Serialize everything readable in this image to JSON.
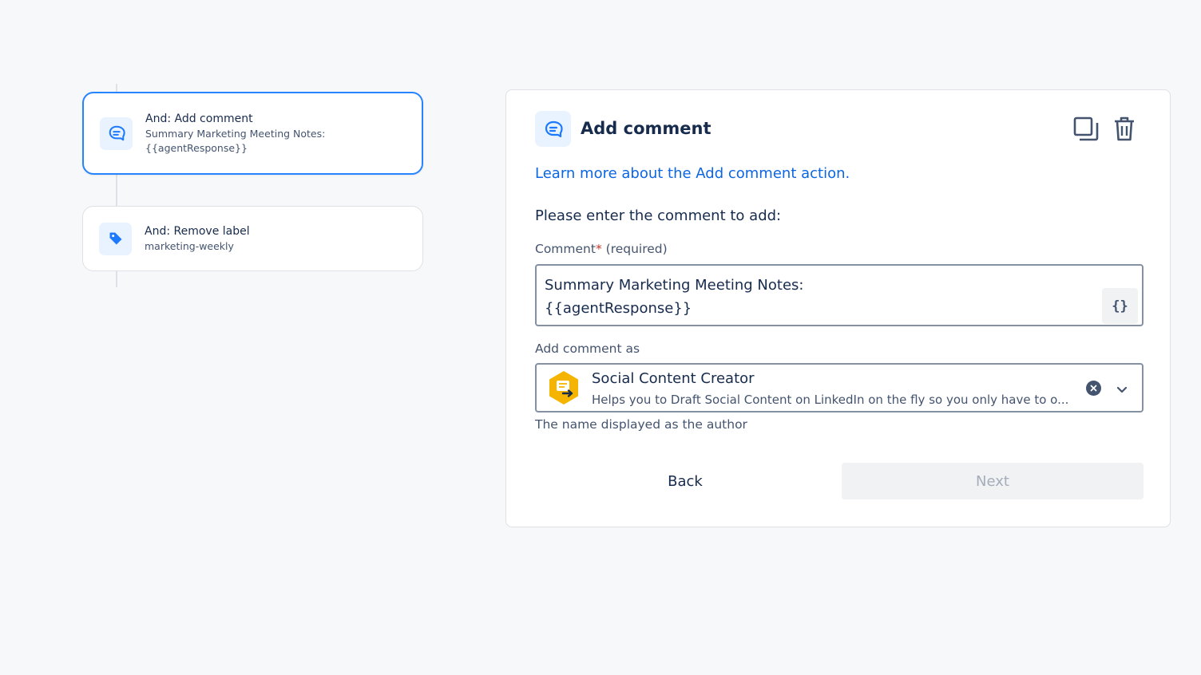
{
  "flow": {
    "items": [
      {
        "title": "And: Add comment",
        "subtitle": "Summary Marketing Meeting Notes: {{agentResponse}}",
        "icon": "comment-icon",
        "selected": true
      },
      {
        "title": "And: Remove label",
        "subtitle": "marketing-weekly",
        "icon": "tag-icon",
        "selected": false
      }
    ]
  },
  "panel": {
    "title": "Add comment",
    "icon": "comment-icon",
    "learn_more_link": "Learn more about the Add comment action.",
    "prompt": "Please enter the comment to add:",
    "comment_field": {
      "label": "Comment",
      "required_marker": "*",
      "required_text": "(required)",
      "value": "Summary Marketing Meeting Notes:\n{{agentResponse}}",
      "variable_button": "{}"
    },
    "author_field": {
      "label": "Add comment as",
      "agent_name": "Social Content Creator",
      "agent_description": "Helps you to Draft Social Content on LinkedIn on the fly so you only have to o...",
      "agent_icon": "agent-icon",
      "helper": "The name displayed as the author"
    },
    "buttons": {
      "back": "Back",
      "next": "Next"
    }
  },
  "colors": {
    "accent": "#0c66e4",
    "selected_border": "#2684ff",
    "icon_bg": "#e9f2ff",
    "agent_badge": "#f5b400",
    "required": "#c9372c"
  }
}
